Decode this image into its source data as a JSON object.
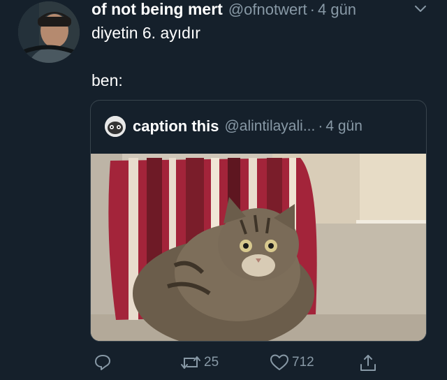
{
  "tweet": {
    "author_name": "of not being mert",
    "author_handle": "@ofnotwert",
    "separator": "·",
    "time": "4 gün",
    "text_line1": "diyetin 6. ayıdır",
    "text_line2": "ben:"
  },
  "quoted": {
    "author_name": "caption this",
    "author_handle": "@alintilayali...",
    "separator": "·",
    "time": "4 gün",
    "media": "cat-on-striped-pillow-photo"
  },
  "actions": {
    "reply_icon": "reply-icon",
    "retweet_icon": "retweet-icon",
    "retweet_count": "25",
    "like_icon": "heart-icon",
    "like_count": "712",
    "share_icon": "share-icon"
  },
  "colors": {
    "background": "#15202b",
    "text": "#ffffff",
    "secondary": "#8899a6",
    "border": "#38444d"
  }
}
